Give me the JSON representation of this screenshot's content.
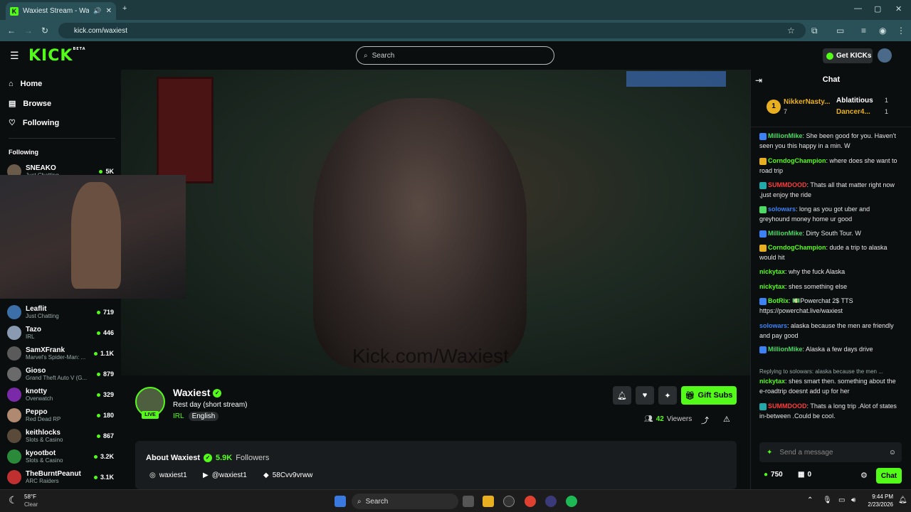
{
  "browser": {
    "tab_title": "Waxiest Stream - Watch Live",
    "url": "kick.com/waxiest"
  },
  "header": {
    "logo": "KICK",
    "logo_badge": "BETA",
    "search_placeholder": "Search",
    "get_kicks": "Get KICKs"
  },
  "nav": {
    "home": "Home",
    "browse": "Browse",
    "following": "Following",
    "following_section": "Following"
  },
  "following": [
    {
      "name": "SNEAKO",
      "category": "Just Chatting",
      "viewers": "5K",
      "color": "#6b5b4b"
    },
    {
      "name": "Leaflit",
      "category": "Just Chatting",
      "viewers": "719",
      "color": "#3c6ea8"
    },
    {
      "name": "Tazo",
      "category": "IRL",
      "viewers": "446",
      "color": "#8a9ab0"
    },
    {
      "name": "SamXFrank",
      "category": "Marvel's Spider-Man: ...",
      "viewers": "1.1K",
      "color": "#5a5a5a"
    },
    {
      "name": "Gioso",
      "category": "Grand Theft Auto V (G...",
      "viewers": "879",
      "color": "#6a6a6a"
    },
    {
      "name": "knotty",
      "category": "Overwatch",
      "viewers": "329",
      "color": "#7a2aa8"
    },
    {
      "name": "Peppo",
      "category": "Red Dead RP",
      "viewers": "180",
      "color": "#b08a70"
    },
    {
      "name": "keithlocks",
      "category": "Slots & Casino",
      "viewers": "867",
      "color": "#5a4a3a"
    },
    {
      "name": "kyootbot",
      "category": "Slots & Casino",
      "viewers": "3.2K",
      "color": "#2a8a3a"
    },
    {
      "name": "TheBurntPeanut",
      "category": "ARC Raiders",
      "viewers": "3.1K",
      "color": "#c03030"
    }
  ],
  "video": {
    "watermark": "Kick.com/Waxiest"
  },
  "stream": {
    "channel": "Waxiest",
    "title": "Rest day (short stream)",
    "category": "IRL",
    "language": "English",
    "live": "LIVE",
    "viewers": "42",
    "viewers_label": "Viewers",
    "gift_subs": "Gift Subs"
  },
  "about": {
    "title": "About Waxiest",
    "followers": "5.9K",
    "followers_label": "Followers",
    "instagram": "waxiest1",
    "youtube": "@waxiest1",
    "discord": "58Cvv9vrww"
  },
  "chat": {
    "title": "Chat",
    "leaders": [
      {
        "rank": "1",
        "name": "NikkerNasty...",
        "count": "7"
      },
      {
        "name": "Ablatitious",
        "count": "1"
      },
      {
        "name": "Dancer4...",
        "count": "1"
      }
    ],
    "messages": [
      {
        "user": "MillionMike",
        "color": "#4cd964",
        "text": ": She been good for you. Haven't seen you this happy in a min. W"
      },
      {
        "user": "CorndogChampion",
        "color": "#53fc18",
        "text": ": where does she want to road trip"
      },
      {
        "user": "SUMMDOOD",
        "color": "#ff3b3b",
        "text": ": Thats all that matter right now ,just enjoy the ride"
      },
      {
        "user": "solowars",
        "color": "#3b82f6",
        "text": ": long as you got uber and greyhound money home ur good"
      },
      {
        "user": "MillionMike",
        "color": "#4cd964",
        "text": ": Dirty South Tour. W"
      },
      {
        "user": "CorndogChampion",
        "color": "#53fc18",
        "text": ": dude a trip to alaska would hit"
      },
      {
        "user": "nickytax",
        "color": "#53fc18",
        "text": ": why the fuck Alaska"
      },
      {
        "user": "nickytax",
        "color": "#53fc18",
        "text": ": shes something else"
      },
      {
        "user": "BotRix",
        "color": "#53fc18",
        "text": ": 💵Powerchat 2$ TTS https://powerchat.live/waxiest"
      },
      {
        "user": "solowars",
        "color": "#3b82f6",
        "text": ": alaska because the men are friendly and pay good"
      },
      {
        "user": "MillionMike",
        "color": "#4cd964",
        "text": ": Alaska a few days drive"
      },
      {
        "user": "nickytax",
        "color": "#53fc18",
        "text": ": shes smart then. something about the e-roadtrip doesnt add up for her"
      },
      {
        "user": "SUMMDOOD",
        "color": "#ff3b3b",
        "text": ": Thats a long trip .Alot of states in-between .Could be cool."
      }
    ],
    "reply_note": "Replying to solowars: alaska because the men ...",
    "input_placeholder": "Send a message",
    "kicks_balance": "750",
    "subs_count": "0",
    "send_label": "Chat"
  },
  "taskbar": {
    "weather_temp": "58°F",
    "weather_desc": "Clear",
    "search": "Search",
    "time": "9:44 PM",
    "date": "2/23/2026"
  },
  "colors": {
    "accent": "#53fc18",
    "bg": "#0b0e0f"
  }
}
